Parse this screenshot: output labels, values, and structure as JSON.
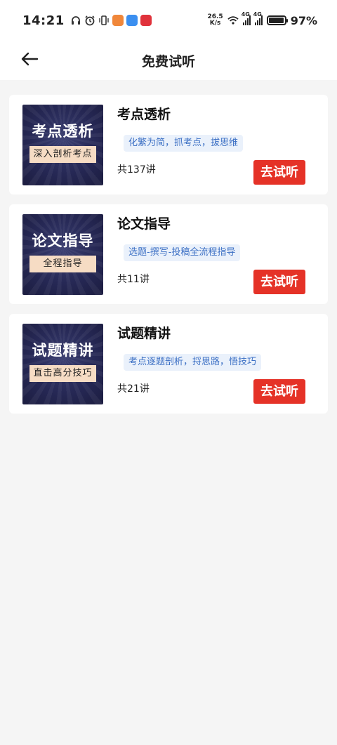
{
  "status_bar": {
    "time": "14:21",
    "net_speed_top": "26.5",
    "net_speed_bottom": "K/s",
    "signal1_label": "4G",
    "signal2_label": "4G",
    "battery_percent": "97%",
    "battery_level": 0.97
  },
  "header": {
    "title": "免费试听",
    "back_icon": "arrow-left-icon"
  },
  "courses": [
    {
      "title": "考点透析",
      "cover_title": "考点透析",
      "cover_subtitle": "深入剖析考点",
      "tag": "化繁为简，抓考点，拔思维",
      "count": "共137讲",
      "button": "去试听"
    },
    {
      "title": "论文指导",
      "cover_title": "论文指导",
      "cover_subtitle": "全程指导",
      "tag": "选题-撰写-投稿全流程指导",
      "count": "共11讲",
      "button": "去试听"
    },
    {
      "title": "试题精讲",
      "cover_title": "试题精讲",
      "cover_subtitle": "直击高分技巧",
      "tag": "考点逐题剖析，捋思路，悟技巧",
      "count": "共21讲",
      "button": "去试听"
    }
  ],
  "colors": {
    "accent": "#e53227",
    "tag_text": "#3b6fc4",
    "tag_bg": "#eaf1fb",
    "cover_bg": "#262855",
    "cover_band": "#f6dcc4"
  }
}
